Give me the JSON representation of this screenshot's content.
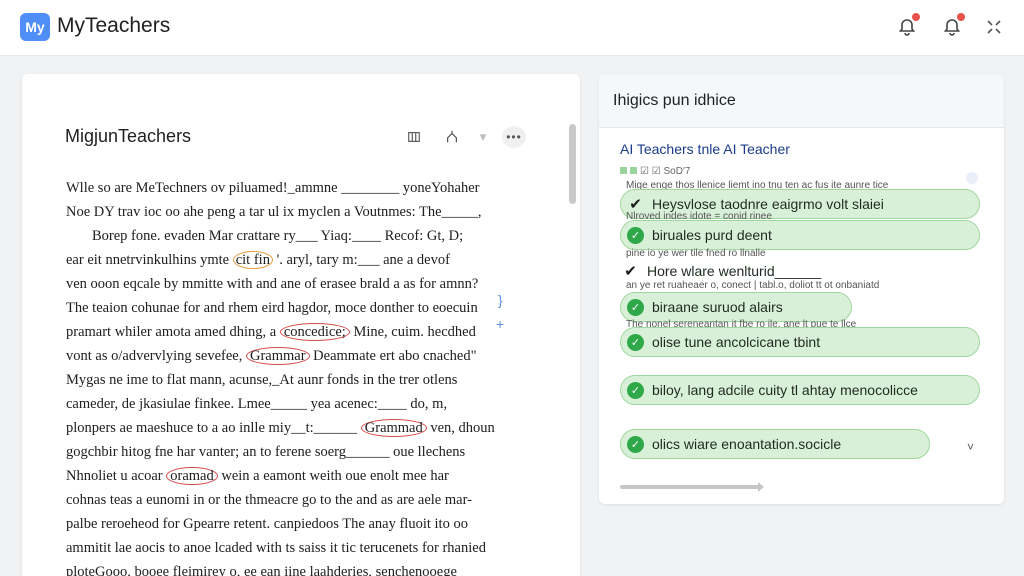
{
  "header": {
    "logo_text": "My",
    "app_title": "MyTeachers"
  },
  "document": {
    "title": "MigjunTeachers",
    "tools": {
      "table_icon": "table-icon",
      "share_icon": "share-icon"
    },
    "lines": [
      "Wlle so are MeTechners ov piluamed!_ammne ________ yoneYohaher",
      "Noe DY trav ioc oo ahe peng a tar ul ix myclen a Voutnmes: The_____,",
      "Borep fone. evaden Mar crattare ry___ Yiaq:____ Recof: Gt, D;",
      "ear eit nnetrvinkulhins ymte",
      "ven ooon eqcale by mmitte with and ane of erasee brald a as for amnn?",
      "The teaion cohunae for and rhem eird hagdor, moce donther to eoecuin",
      "pramart whiler amota amed dhing, a",
      "vont as o/advervlying sevefee,",
      "Mygas ne ime to flat mann, acunse,_At aunr fonds in the trer otlens",
      "cameder, de jkasiulae finkee. Lmee_____ yea acenec:____ do, m,",
      "plonpers ae maeshuce to a ao inlle miy__t:______",
      "gogchbir hitog fne har vanter; an to ferene soerg______ oue llechens",
      "Nhnoliet u acoar",
      "cohnas teas a eunomi in or the thmeacre go to the and as are aele mar-",
      "palbe reroeheod for Gpearre retent. canpiedoos The anay fluoit ito oo",
      "ammitit lae aocis to anoe lcaded with ts saiss it tic terucenets for rhanied",
      "ploteGooo, booee fleimirey o, ee ean iine laahderies, senchenooege"
    ],
    "circled": {
      "fin": "cit fin",
      "tail_a": "'. aryl,",
      "tail_b": "tary m:___ ane a devof",
      "concedice": "concedice;",
      "line6_tail": "Mine, cuim. hecdhed",
      "grammar": "Grammar",
      "line7_tail": "Deammate ert abo cnached\"",
      "grammad": "Grammad",
      "line10_tail": "ven, dhoun",
      "ordmad": "oramad",
      "line12_tail": "wein a eamont weith oue enolt mee har"
    },
    "markers": {
      "bracket": "}",
      "plus": "+"
    }
  },
  "suggestions": {
    "panel_title": "Ihigics pun idhice",
    "subtitle": "AI Teachers tnle AI Teacher",
    "tiny_header": "☑ ☑ SoD'7",
    "notes": [
      "Mige enge thos llenice liemt ino tnu ten ac   fus ite aunre tice",
      "Nlroved indes idote = conid rinee",
      "pine io ye wer tile fned ro llnalle",
      "an ye ret ruaheaer o, conect | tabl.o, doliot tt ot onbaniatd",
      "The nonel sereneantan it fbe ro ile, ane lt pue te llce"
    ],
    "items": [
      {
        "text": "Heysvlose taodnre eaigrmo volt slaiei",
        "style": "outline"
      },
      {
        "text": "biruales purd deent",
        "style": "filled"
      },
      {
        "text": "Hore wlare wenlturid______",
        "style": "plain"
      },
      {
        "text": "biraane suruod alairs",
        "style": "filled"
      },
      {
        "text": "olise tune ancolcicane tbint",
        "style": "filled"
      },
      {
        "text": "biloy, lang adcile cuity tl ahtay menocolicce",
        "style": "filled"
      },
      {
        "text": "olics wiare enoantation.socicle",
        "style": "filled"
      }
    ],
    "chevron": "˅"
  },
  "icons": {
    "notification_1": "bell-icon",
    "notification_2": "bell-icon",
    "fullscreen": "expand-icon"
  },
  "colors": {
    "brand": "#4f8ef7",
    "suggestion_fill": "#d8f0d8",
    "check_green": "#2fa84a",
    "circle_red": "#d94c4c",
    "notification_dot": "#e8534b"
  }
}
